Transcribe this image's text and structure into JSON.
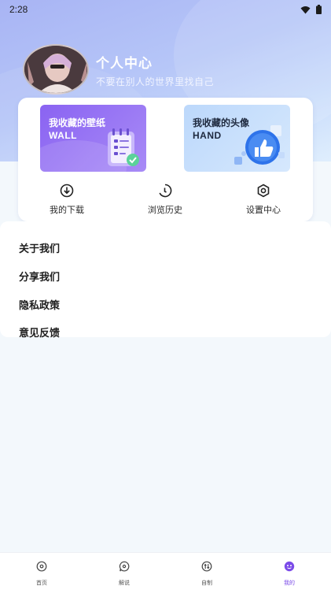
{
  "status_bar": {
    "time": "2:28"
  },
  "profile": {
    "name": "个人中心",
    "subtitle": "不要在别人的世界里找自己"
  },
  "favorites": [
    {
      "title": "我收藏的壁纸",
      "subtitle": "WALL",
      "icon": "notebook-icon",
      "color": "#8a63f2"
    },
    {
      "title": "我收藏的头像",
      "subtitle": "HAND",
      "icon": "thumbs-up-icon",
      "color": "#bcd8fb"
    }
  ],
  "shortcuts": [
    {
      "label": "我的下载",
      "icon": "download-icon"
    },
    {
      "label": "浏览历史",
      "icon": "history-icon"
    },
    {
      "label": "设置中心",
      "icon": "settings-icon"
    }
  ],
  "menu": [
    {
      "label": "关于我们"
    },
    {
      "label": "分享我们"
    },
    {
      "label": "隐私政策"
    },
    {
      "label": "意见反馈"
    }
  ],
  "bottom_nav": [
    {
      "label": "首页",
      "icon": "home-icon",
      "active": false
    },
    {
      "label": "解说",
      "icon": "commentary-icon",
      "active": false
    },
    {
      "label": "自制",
      "icon": "custom-icon",
      "active": false
    },
    {
      "label": "我的",
      "icon": "profile-icon",
      "active": true
    }
  ],
  "colors": {
    "accent": "#7b4be8",
    "header_gradient_start": "#a8b4f4",
    "page_bg": "#f3f8fc"
  }
}
